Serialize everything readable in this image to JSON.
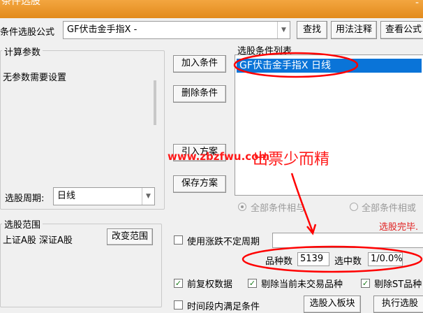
{
  "window": {
    "title": "条件选股",
    "close_glyph": "-"
  },
  "formula": {
    "label": "条件选股公式",
    "value": "GF伏击金手指X  -",
    "find_button": "查找",
    "usage_button": "用法注释",
    "view_button": "查看公式"
  },
  "params": {
    "legend": "计算参数",
    "text": "无参数需要设置"
  },
  "period": {
    "label": "选股周期:",
    "value": "日线"
  },
  "actions": {
    "add": "加入条件",
    "delete": "删除条件",
    "import": "引入方案",
    "save": "保存方案"
  },
  "conditions": {
    "legend": "选股条件列表",
    "items": [
      "GF伏击金手指X  日线"
    ],
    "all_and": "全部条件相与",
    "all_or": "全部条件相或",
    "status": "选股完毕."
  },
  "watermark": {
    "url": "www.zbzfwu.com",
    "slogan": "出票少而精"
  },
  "range": {
    "legend": "选股范围",
    "text": "上证A股 深证A股",
    "change_button": "改变范围"
  },
  "options": {
    "variable_period": "使用涨跌不定周期",
    "forward_adjust": "前复权数据",
    "exclude_untraded": "剔除当前未交易品种",
    "exclude_st": "剔除ST品种",
    "time_range": "时间段内满足条件"
  },
  "stats": {
    "count_label": "品种数",
    "count_value": "5139",
    "selected_label": "选中数",
    "selected_value": "1/0.0%"
  },
  "bottom_buttons": {
    "to_block": "选股入板块",
    "execute": "执行选股"
  },
  "colors": {
    "titlebar": "#e8931f",
    "selection": "#0a74d8",
    "annotation": "#ff0000",
    "check": "#1a7a1a"
  }
}
